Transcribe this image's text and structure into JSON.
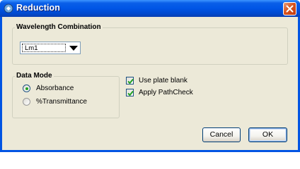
{
  "window": {
    "title": "Reduction"
  },
  "wavelength_combination": {
    "label": "Wavelength Combination",
    "selected": "Lm1"
  },
  "data_mode": {
    "label": "Data Mode",
    "options": [
      {
        "label": "Absorbance",
        "selected": true
      },
      {
        "label": "%Transmittance",
        "selected": false
      }
    ]
  },
  "checkboxes": [
    {
      "label": "Use plate blank",
      "checked": true
    },
    {
      "label": "Apply PathCheck",
      "checked": true
    }
  ],
  "buttons": {
    "cancel": "Cancel",
    "ok": "OK"
  },
  "icons": {
    "app": "app-icon",
    "close": "close-icon",
    "dropdown": "chevron-down-icon"
  },
  "colors": {
    "titlebar": "#0055e5",
    "close": "#d9541e",
    "client": "#ece9d8",
    "check": "#21a121"
  }
}
